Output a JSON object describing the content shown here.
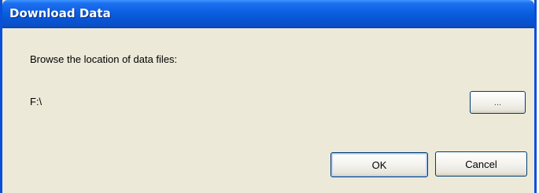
{
  "window": {
    "title": "Download Data"
  },
  "content": {
    "prompt_label": "Browse the location of data files:",
    "path_value": "F:\\"
  },
  "buttons": {
    "browse_label": "...",
    "ok_label": "OK",
    "cancel_label": "Cancel"
  },
  "colors": {
    "titlebar": "#0a5fe0",
    "frame": "#0a4fd8",
    "client_background": "#ece9d8"
  }
}
